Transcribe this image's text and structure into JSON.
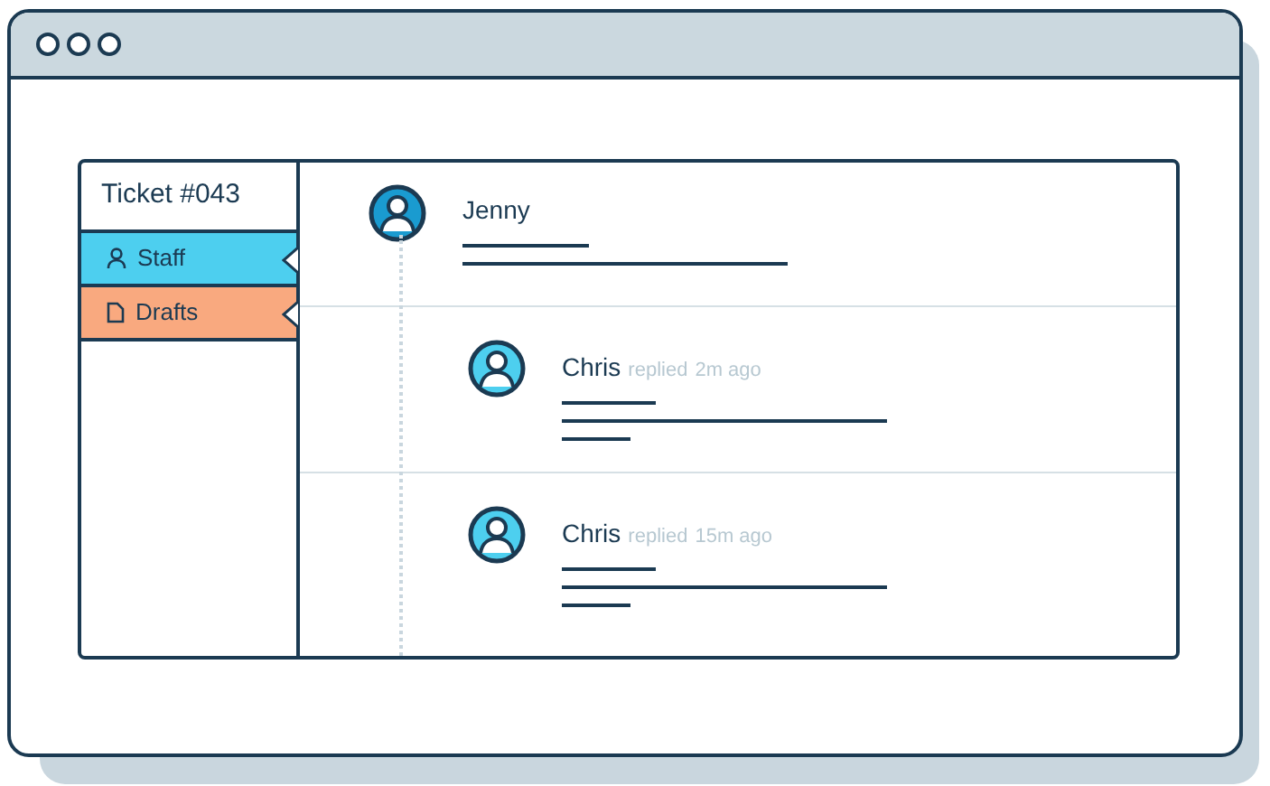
{
  "sidebar": {
    "title": "Ticket #043",
    "items": [
      {
        "label": "Staff",
        "kind": "person",
        "color": "#4dcfef"
      },
      {
        "label": "Drafts",
        "kind": "document",
        "color": "#f9a97f"
      }
    ]
  },
  "messages": [
    {
      "kind": "original",
      "author": "Jenny"
    },
    {
      "kind": "reply",
      "author": "Chris",
      "action": "replied",
      "time": "2m ago"
    },
    {
      "kind": "reply",
      "author": "Chris",
      "action": "replied",
      "time": "15m ago"
    }
  ]
}
